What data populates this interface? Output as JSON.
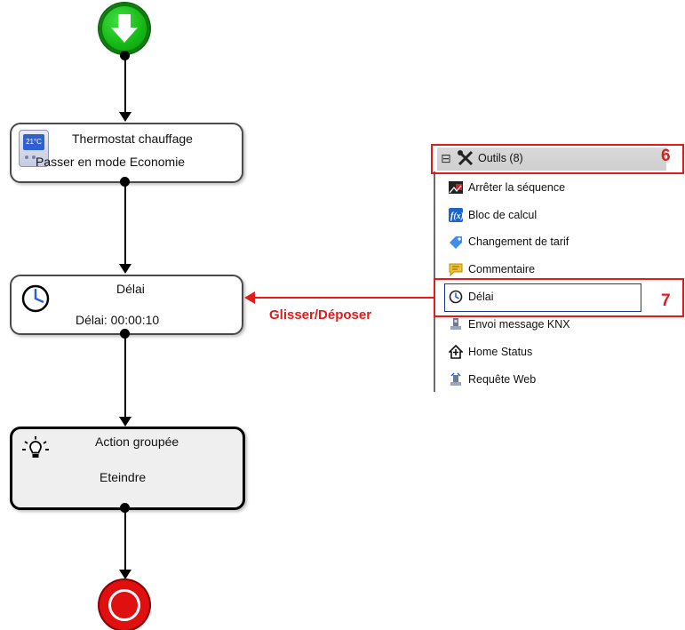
{
  "flow": {
    "start_icon": "green-down-arrow-icon",
    "end_icon": "red-stop-icon",
    "blocks": [
      {
        "title": "Thermostat chauffage",
        "value": "Passer en mode Economie",
        "icon": "thermostat-icon",
        "thermo_text": "21°C"
      },
      {
        "title": "Délai",
        "value": "Délai: 00:00:10",
        "icon": "clock-icon"
      },
      {
        "title": "Action groupée",
        "value": "Eteindre",
        "icon": "bulb-icon"
      }
    ]
  },
  "drag_drop_label": "Glisser/Déposer",
  "toolbox": {
    "collapse_glyph": "⊟",
    "group_label": "Outils (8)",
    "items": [
      {
        "label": "Arrêter la séquence",
        "icon": "stop-sequence-icon"
      },
      {
        "label": "Bloc de calcul",
        "icon": "function-icon"
      },
      {
        "label": "Changement de tarif",
        "icon": "tag-icon"
      },
      {
        "label": "Commentaire",
        "icon": "comment-icon"
      },
      {
        "label": "Délai",
        "icon": "clock-icon"
      },
      {
        "label": "Envoi message KNX",
        "icon": "knx-message-icon"
      },
      {
        "label": "Home Status",
        "icon": "home-status-icon"
      },
      {
        "label": "Requête Web",
        "icon": "web-request-icon"
      }
    ]
  },
  "callouts": {
    "six": "6",
    "seven": "7"
  },
  "colors": {
    "accent_red": "#e31b1b",
    "start_green": "#14b814",
    "end_red": "#e01010",
    "selection_blue": "#1d3a8a"
  }
}
